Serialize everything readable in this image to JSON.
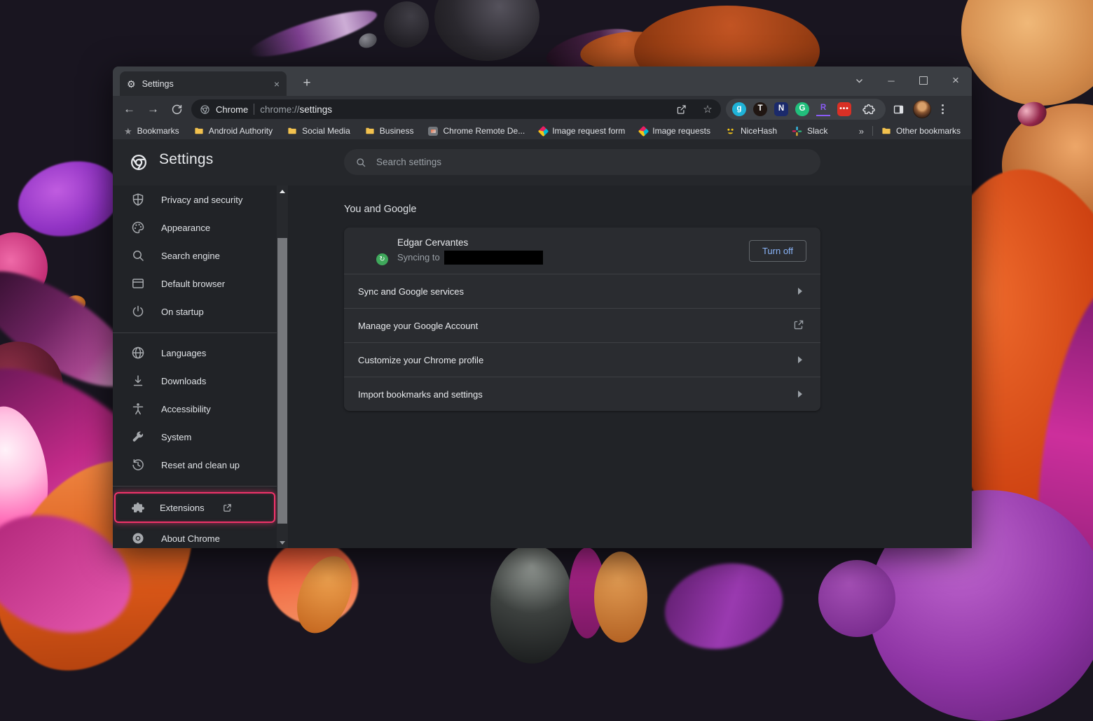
{
  "tab": {
    "title": "Settings"
  },
  "omnibox": {
    "engine": "Chrome",
    "url_scheme": "chrome://",
    "url_path": "settings"
  },
  "toolbar_extensions": [
    {
      "label": "g",
      "bg": "#1fb3d8",
      "shape": "circle"
    },
    {
      "label": "T",
      "bg": "#201612",
      "shape": "circle"
    },
    {
      "label": "N",
      "bg": "#1b2a6b",
      "shape": "square"
    },
    {
      "label": "G",
      "bg": "#21bf7c",
      "shape": "circle"
    },
    {
      "label": "R",
      "bg": "transparent",
      "shape": "letter"
    },
    {
      "label": "•••",
      "bg": "#d93025",
      "shape": "square"
    }
  ],
  "bookmarks": {
    "items": [
      {
        "label": "Bookmarks",
        "icon": "star-icon"
      },
      {
        "label": "Android Authority",
        "icon": "folder-icon"
      },
      {
        "label": "Social Media",
        "icon": "folder-icon"
      },
      {
        "label": "Business",
        "icon": "folder-icon"
      },
      {
        "label": "Chrome Remote De...",
        "icon": "remote-desktop-icon"
      },
      {
        "label": "Image request form",
        "icon": "forms-icon"
      },
      {
        "label": "Image requests",
        "icon": "forms-icon"
      },
      {
        "label": "NiceHash",
        "icon": "nicehash-icon"
      },
      {
        "label": "Slack",
        "icon": "slack-icon"
      }
    ],
    "overflow": "»",
    "other_bookmarks": "Other bookmarks"
  },
  "settings": {
    "page_title": "Settings",
    "search_placeholder": "Search settings",
    "sidebar": [
      {
        "label": "Privacy and security",
        "icon": "shield-icon"
      },
      {
        "label": "Appearance",
        "icon": "palette-icon"
      },
      {
        "label": "Search engine",
        "icon": "search-icon"
      },
      {
        "label": "Default browser",
        "icon": "browser-icon"
      },
      {
        "label": "On startup",
        "icon": "power-icon"
      },
      {
        "label": "Languages",
        "icon": "globe-icon"
      },
      {
        "label": "Downloads",
        "icon": "download-icon"
      },
      {
        "label": "Accessibility",
        "icon": "accessibility-icon"
      },
      {
        "label": "System",
        "icon": "wrench-icon"
      },
      {
        "label": "Reset and clean up",
        "icon": "history-icon"
      },
      {
        "label": "Extensions",
        "icon": "puzzle-icon"
      },
      {
        "label": "About Chrome",
        "icon": "chrome-icon"
      }
    ],
    "section_title": "You and Google",
    "profile": {
      "name": "Edgar Cervantes",
      "sync_text": "Syncing to",
      "turnoff_label": "Turn off"
    },
    "rows": [
      {
        "label": "Sync and Google services",
        "trailing": "chevron-right-icon"
      },
      {
        "label": "Manage your Google Account",
        "trailing": "external-link-icon"
      },
      {
        "label": "Customize your Chrome profile",
        "trailing": "chevron-right-icon"
      },
      {
        "label": "Import bookmarks and settings",
        "trailing": "chevron-right-icon"
      }
    ]
  },
  "colors": {
    "accent_blue": "#8ab4f8",
    "highlight_pink": "#f0336a",
    "folder_yellow": "#f2c14e",
    "sync_green": "#3fa85b"
  }
}
